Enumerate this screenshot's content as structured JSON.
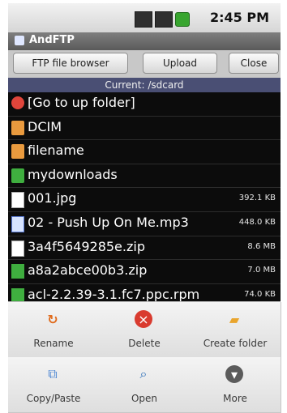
{
  "status_bar": {
    "time": "2:45 PM",
    "icons": [
      "network-icon",
      "signal-icon",
      "battery-icon"
    ]
  },
  "app": {
    "title": "AndFTP"
  },
  "toolbar": {
    "ftp_label": "FTP file browser",
    "upload_label": "Upload",
    "close_label": "Close"
  },
  "path": {
    "current": "Current: /sdcard"
  },
  "files": [
    {
      "name": "[Go to up folder]",
      "size": "",
      "icon": "up-folder-icon"
    },
    {
      "name": "DCIM",
      "size": "",
      "icon": "folder-icon"
    },
    {
      "name": "filename",
      "size": "",
      "icon": "folder-icon"
    },
    {
      "name": "mydownloads",
      "size": "",
      "icon": "download-folder-icon"
    },
    {
      "name": "001.jpg",
      "size": "392.1 KB",
      "icon": "image-file-icon"
    },
    {
      "name": "02 - Push Up On Me.mp3",
      "size": "448.0 KB",
      "icon": "audio-file-icon"
    },
    {
      "name": "3a4f5649285e.zip",
      "size": "8.6 MB",
      "icon": "zip-file-icon"
    },
    {
      "name": "a8a2abce00b3.zip",
      "size": "7.0 MB",
      "icon": "zip-download-icon"
    },
    {
      "name": "acl-2.2.39-3.1.fc7.ppc.rpm",
      "size": "74.0 KB",
      "icon": "rpm-file-icon"
    }
  ],
  "menu": {
    "rename": "Rename",
    "delete": "Delete",
    "create_folder": "Create folder",
    "copy_paste": "Copy/Paste",
    "open": "Open",
    "more": "More"
  },
  "colors": {
    "list_background": "#0c0c0c",
    "path_bar": "#4a4f74",
    "menu_background": "#dcdcdc"
  }
}
